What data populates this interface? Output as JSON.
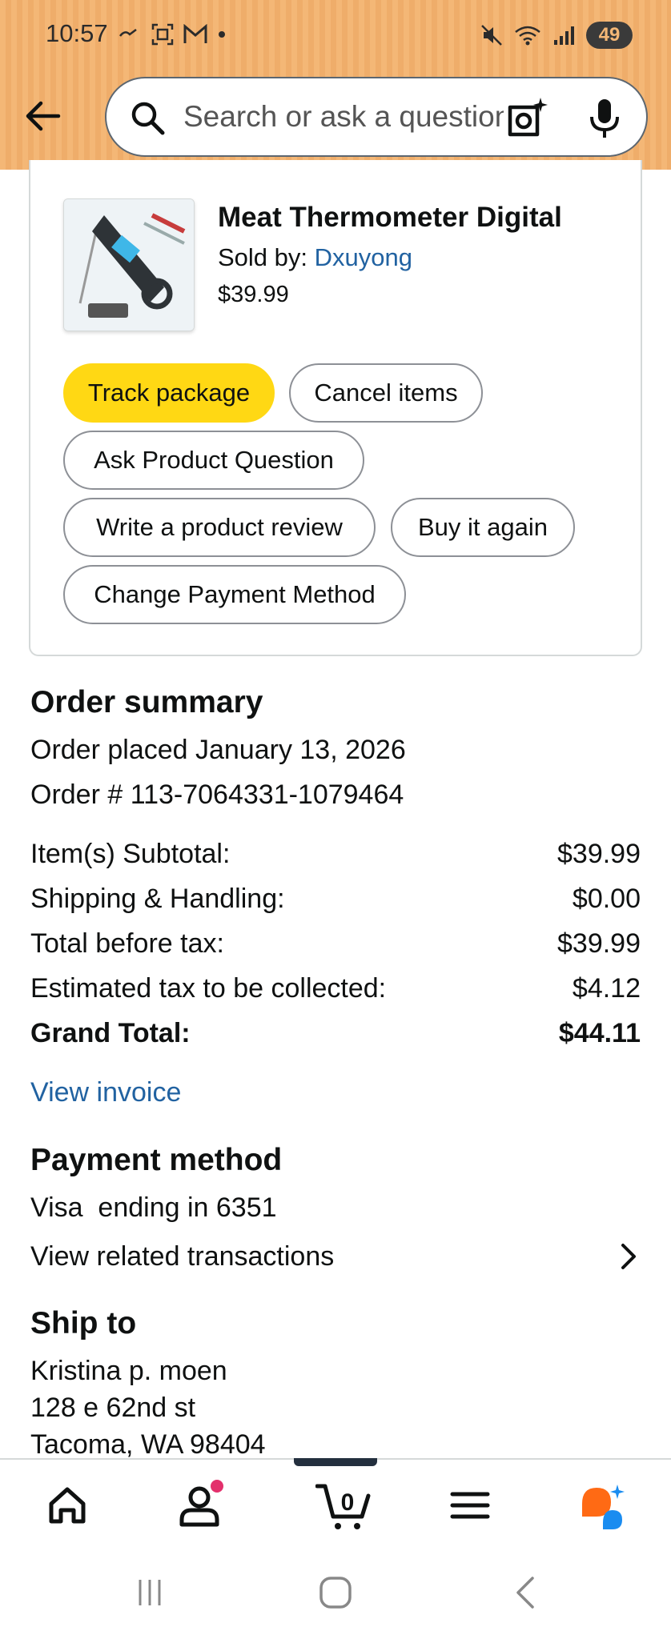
{
  "status_bar": {
    "time": "10:57",
    "battery": "49"
  },
  "header": {
    "search_placeholder": "Search or ask a question"
  },
  "product": {
    "title": "Meat Thermometer Digital",
    "sold_by_label": "Sold by: ",
    "seller": "Dxuyong",
    "price": "$39.99"
  },
  "actions": {
    "track_package": "Track package",
    "cancel_items": "Cancel items",
    "ask_question": "Ask Product Question",
    "write_review": "Write a product review",
    "buy_again": "Buy it again",
    "change_payment": "Change Payment Method"
  },
  "order_summary": {
    "title": "Order summary",
    "placed": "Order placed January 13, 2026",
    "order_number": "Order # 113-7064331-1079464",
    "rows": [
      {
        "label": "Item(s) Subtotal:",
        "value": "$39.99"
      },
      {
        "label": "Shipping & Handling:",
        "value": "$0.00"
      },
      {
        "label": "Total before tax:",
        "value": "$39.99"
      },
      {
        "label": "Estimated tax to be collected:",
        "value": "$4.12"
      },
      {
        "label": "Grand Total:",
        "value": "$44.11"
      }
    ],
    "view_invoice": "View invoice"
  },
  "payment": {
    "title": "Payment method",
    "card": "Visa  ending in 6351",
    "related": "View related transactions"
  },
  "ship_to": {
    "title": "Ship to",
    "name": "Kristina p. moen",
    "street": "128 e 62nd st",
    "city": "Tacoma, WA 98404"
  },
  "bottom_nav": {
    "cart_count": "0"
  },
  "colors": {
    "header_bg": "#f4b776",
    "primary_button": "#ffd814",
    "link": "#2162a1",
    "notification_dot": "#e3306c",
    "assistant_orange": "#ff6a14",
    "assistant_blue": "#1a8cf0"
  },
  "icons": {
    "back": "arrow-left-icon",
    "search": "magnifier-icon",
    "camera": "camera-sparkle-icon",
    "mic": "microphone-icon",
    "chevron": "chevron-right-icon",
    "home": "home-icon",
    "account": "person-icon",
    "cart": "cart-icon",
    "menu": "hamburger-icon",
    "assistant": "rufus-icon"
  }
}
